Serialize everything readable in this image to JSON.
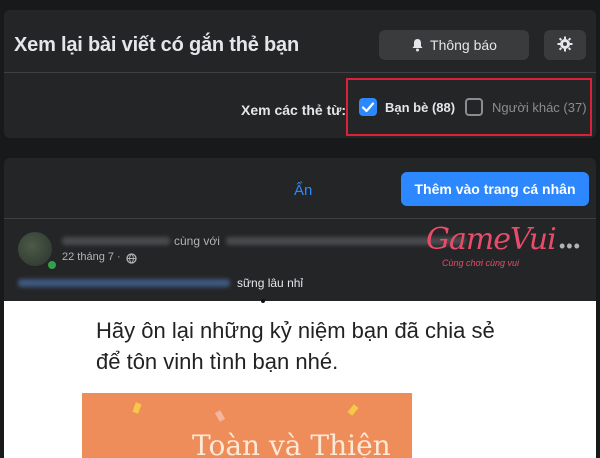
{
  "header": {
    "title": "Xem lại bài viết có gắn thẻ bạn",
    "notifications_label": "Thông báo"
  },
  "filter": {
    "label": "Xem các thẻ từ:",
    "friends_label": "Bạn bè (88)",
    "friends_checked": true,
    "others_label": "Người khác (37)",
    "others_checked": false
  },
  "post_actions": {
    "hide_label": "Ẩn",
    "add_label": "Thêm vào trang cá nhân"
  },
  "post": {
    "name_fragment": "cùng với",
    "date": "22 tháng 7 ·",
    "caption": "sững lâu nhỉ",
    "image_text": "Hãy ôn lại những kỷ niệm bạn đã chia sẻ để tôn vinh tình bạn nhé.",
    "image_names": "Toàn và Thiện"
  },
  "watermark": {
    "brand": "GameVui",
    "tagline": "Cùng chơi cùng vui"
  },
  "colors": {
    "accent": "#2d88ff",
    "highlight_box": "#d9223a",
    "card_bg": "#242526",
    "page_bg": "#18191a"
  }
}
